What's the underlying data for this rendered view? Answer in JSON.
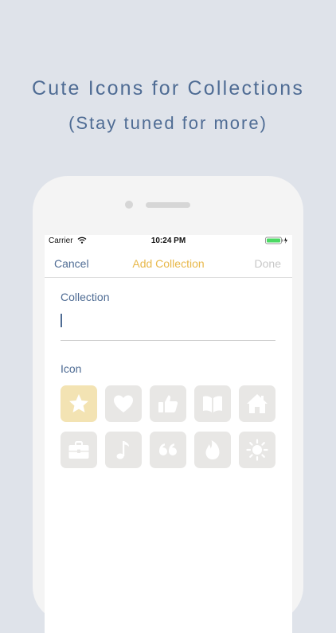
{
  "headline": {
    "line1": "Cute Icons for Collections",
    "line2": "(Stay tuned for more)"
  },
  "status_bar": {
    "carrier": "Carrier",
    "time": "10:24 PM"
  },
  "nav": {
    "cancel": "Cancel",
    "title": "Add Collection",
    "done": "Done"
  },
  "form": {
    "collection_label": "Collection",
    "collection_value": "",
    "icon_label": "Icon"
  },
  "icons": [
    {
      "name": "star-icon",
      "selected": true
    },
    {
      "name": "heart-icon",
      "selected": false
    },
    {
      "name": "thumbs-up-icon",
      "selected": false
    },
    {
      "name": "book-icon",
      "selected": false
    },
    {
      "name": "home-icon",
      "selected": false
    },
    {
      "name": "briefcase-icon",
      "selected": false
    },
    {
      "name": "music-note-icon",
      "selected": false
    },
    {
      "name": "quote-icon",
      "selected": false
    },
    {
      "name": "flame-icon",
      "selected": false
    },
    {
      "name": "sun-icon",
      "selected": false
    }
  ],
  "colors": {
    "accent": "#e8b84a",
    "primary": "#4f6c94",
    "tile": "#e8e7e5",
    "tile_selected": "#f3e3b3",
    "background": "#dfe3ea"
  }
}
